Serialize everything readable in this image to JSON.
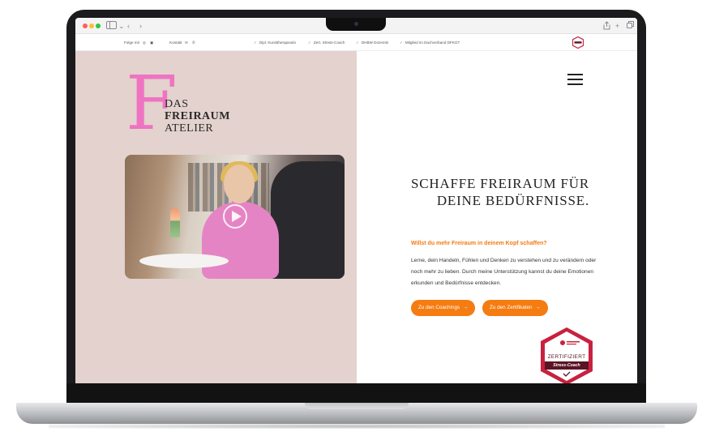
{
  "info_bar": {
    "follow_label": "Folge mir",
    "contact_label": "Kontakt",
    "qualifications": [
      "Dipl. Kunsttherapeutin",
      "Zert. Stress-Coach",
      "DHBW Dozentin",
      "Mitglied im Dachverband DFKGT"
    ]
  },
  "logo": {
    "initial": "F",
    "line1": "DAS",
    "line2": "FREIRAUM",
    "line3": "ATELIER"
  },
  "hero": {
    "headline_line1": "SCHAFFE FREIRAUM FÜR",
    "headline_line2": "DEINE BEDÜRFNISSE.",
    "subheadline": "Willst du mehr Freiraum in deinem Kopf schaffen?",
    "body": "Lerne, dein Handeln, Fühlen und Denken zu verstehen und zu verändern oder noch mehr zu lieben. Durch meine Unterstützung kannst du deine Emotionen erkunden und Bedürfnisse entdecken.",
    "button_coachings": "Zu den Coachings",
    "button_certificates": "Zu den Zertifikaten"
  },
  "badge": {
    "main": "ZERTIFIZIERT",
    "sub": "Stress-Coach"
  },
  "colors": {
    "accent": "#f57c10",
    "brand_pink": "#ee74c2",
    "panel_bg": "#e3d2cd",
    "badge_red": "#c8213f",
    "badge_dark": "#5a1424"
  },
  "icons": {
    "browser_sidebar": "sidebar-icon",
    "back": "chevron-left-icon",
    "forward": "chevron-right-icon",
    "share": "share-icon",
    "new_tab": "plus-icon",
    "tabs": "tabs-icon",
    "instagram": "instagram-icon",
    "linkedin": "linkedin-icon",
    "mail": "mail-icon",
    "phone": "phone-icon",
    "menu": "hamburger-icon",
    "play": "play-icon"
  }
}
